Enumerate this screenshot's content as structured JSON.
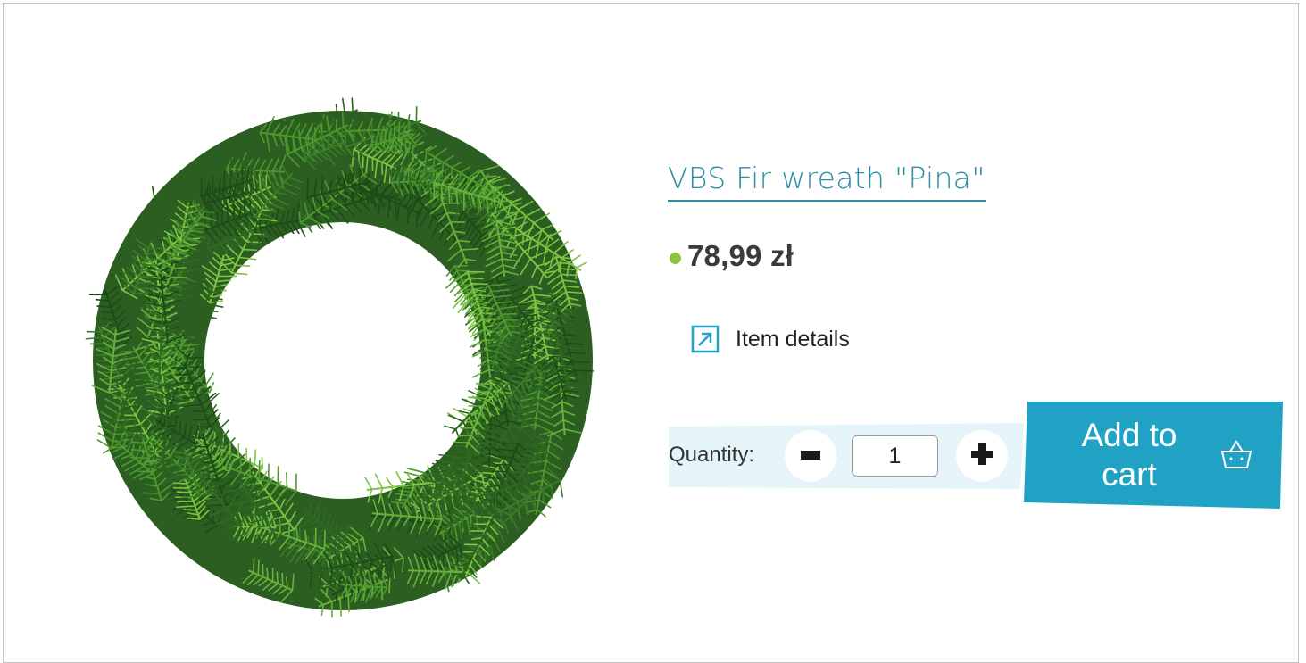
{
  "product": {
    "title": "VBS Fir wreath \"Pina\"",
    "price": "78,99 zł",
    "availability_color": "#8cc63f",
    "details_label": "Item details",
    "details_icon": "external-link-icon",
    "image_subject": "fir-wreath-image"
  },
  "cart": {
    "quantity_label": "Quantity:",
    "quantity_value": "1",
    "minus_icon": "minus-icon",
    "plus_icon": "plus-icon",
    "add_to_cart_label": "Add to cart",
    "basket_icon": "basket-icon"
  },
  "colors": {
    "accent": "#2d8ea6",
    "button_bg": "#1fa2c4",
    "quantity_panel_bg": "#e4f4f9",
    "border": "#c4c4c4"
  }
}
